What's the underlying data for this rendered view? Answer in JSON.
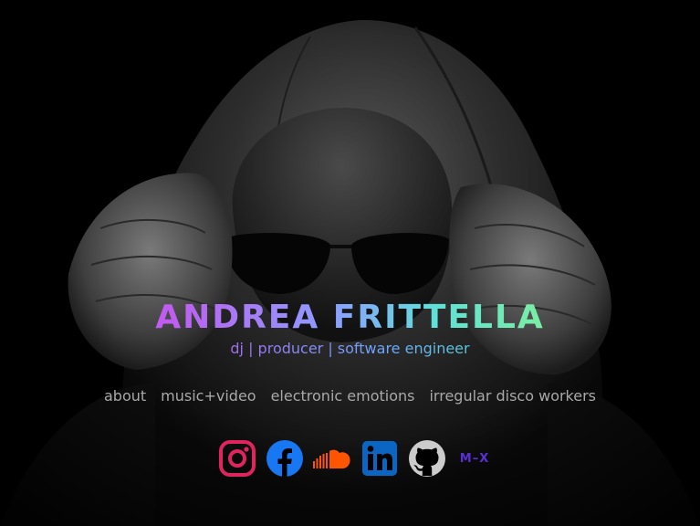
{
  "header": {
    "name_part1": "ANDREA",
    "name_part2": "FRITTELLA",
    "tagline": "dj | producer | software engineer"
  },
  "nav": {
    "items": [
      {
        "label": "about"
      },
      {
        "label": "music+video"
      },
      {
        "label": "electronic emotions"
      },
      {
        "label": "irregular disco workers"
      }
    ]
  },
  "socials": [
    {
      "icon": "instagram-icon",
      "color": "#e0245e"
    },
    {
      "icon": "facebook-icon",
      "color": "#1877f2"
    },
    {
      "icon": "soundcloud-icon",
      "color": "#ff5500"
    },
    {
      "icon": "linkedin-icon",
      "color": "#0a66c2"
    },
    {
      "icon": "github-icon",
      "color": "#cccccc"
    },
    {
      "icon": "mixcloud-icon",
      "color": "#5a2fd6",
      "label": "M–X"
    }
  ],
  "colors": {
    "background": "#000000",
    "nav_text": "#a8a8a8",
    "title_gradient_start": "#c05cf0",
    "title_gradient_end": "#7ff09a"
  }
}
